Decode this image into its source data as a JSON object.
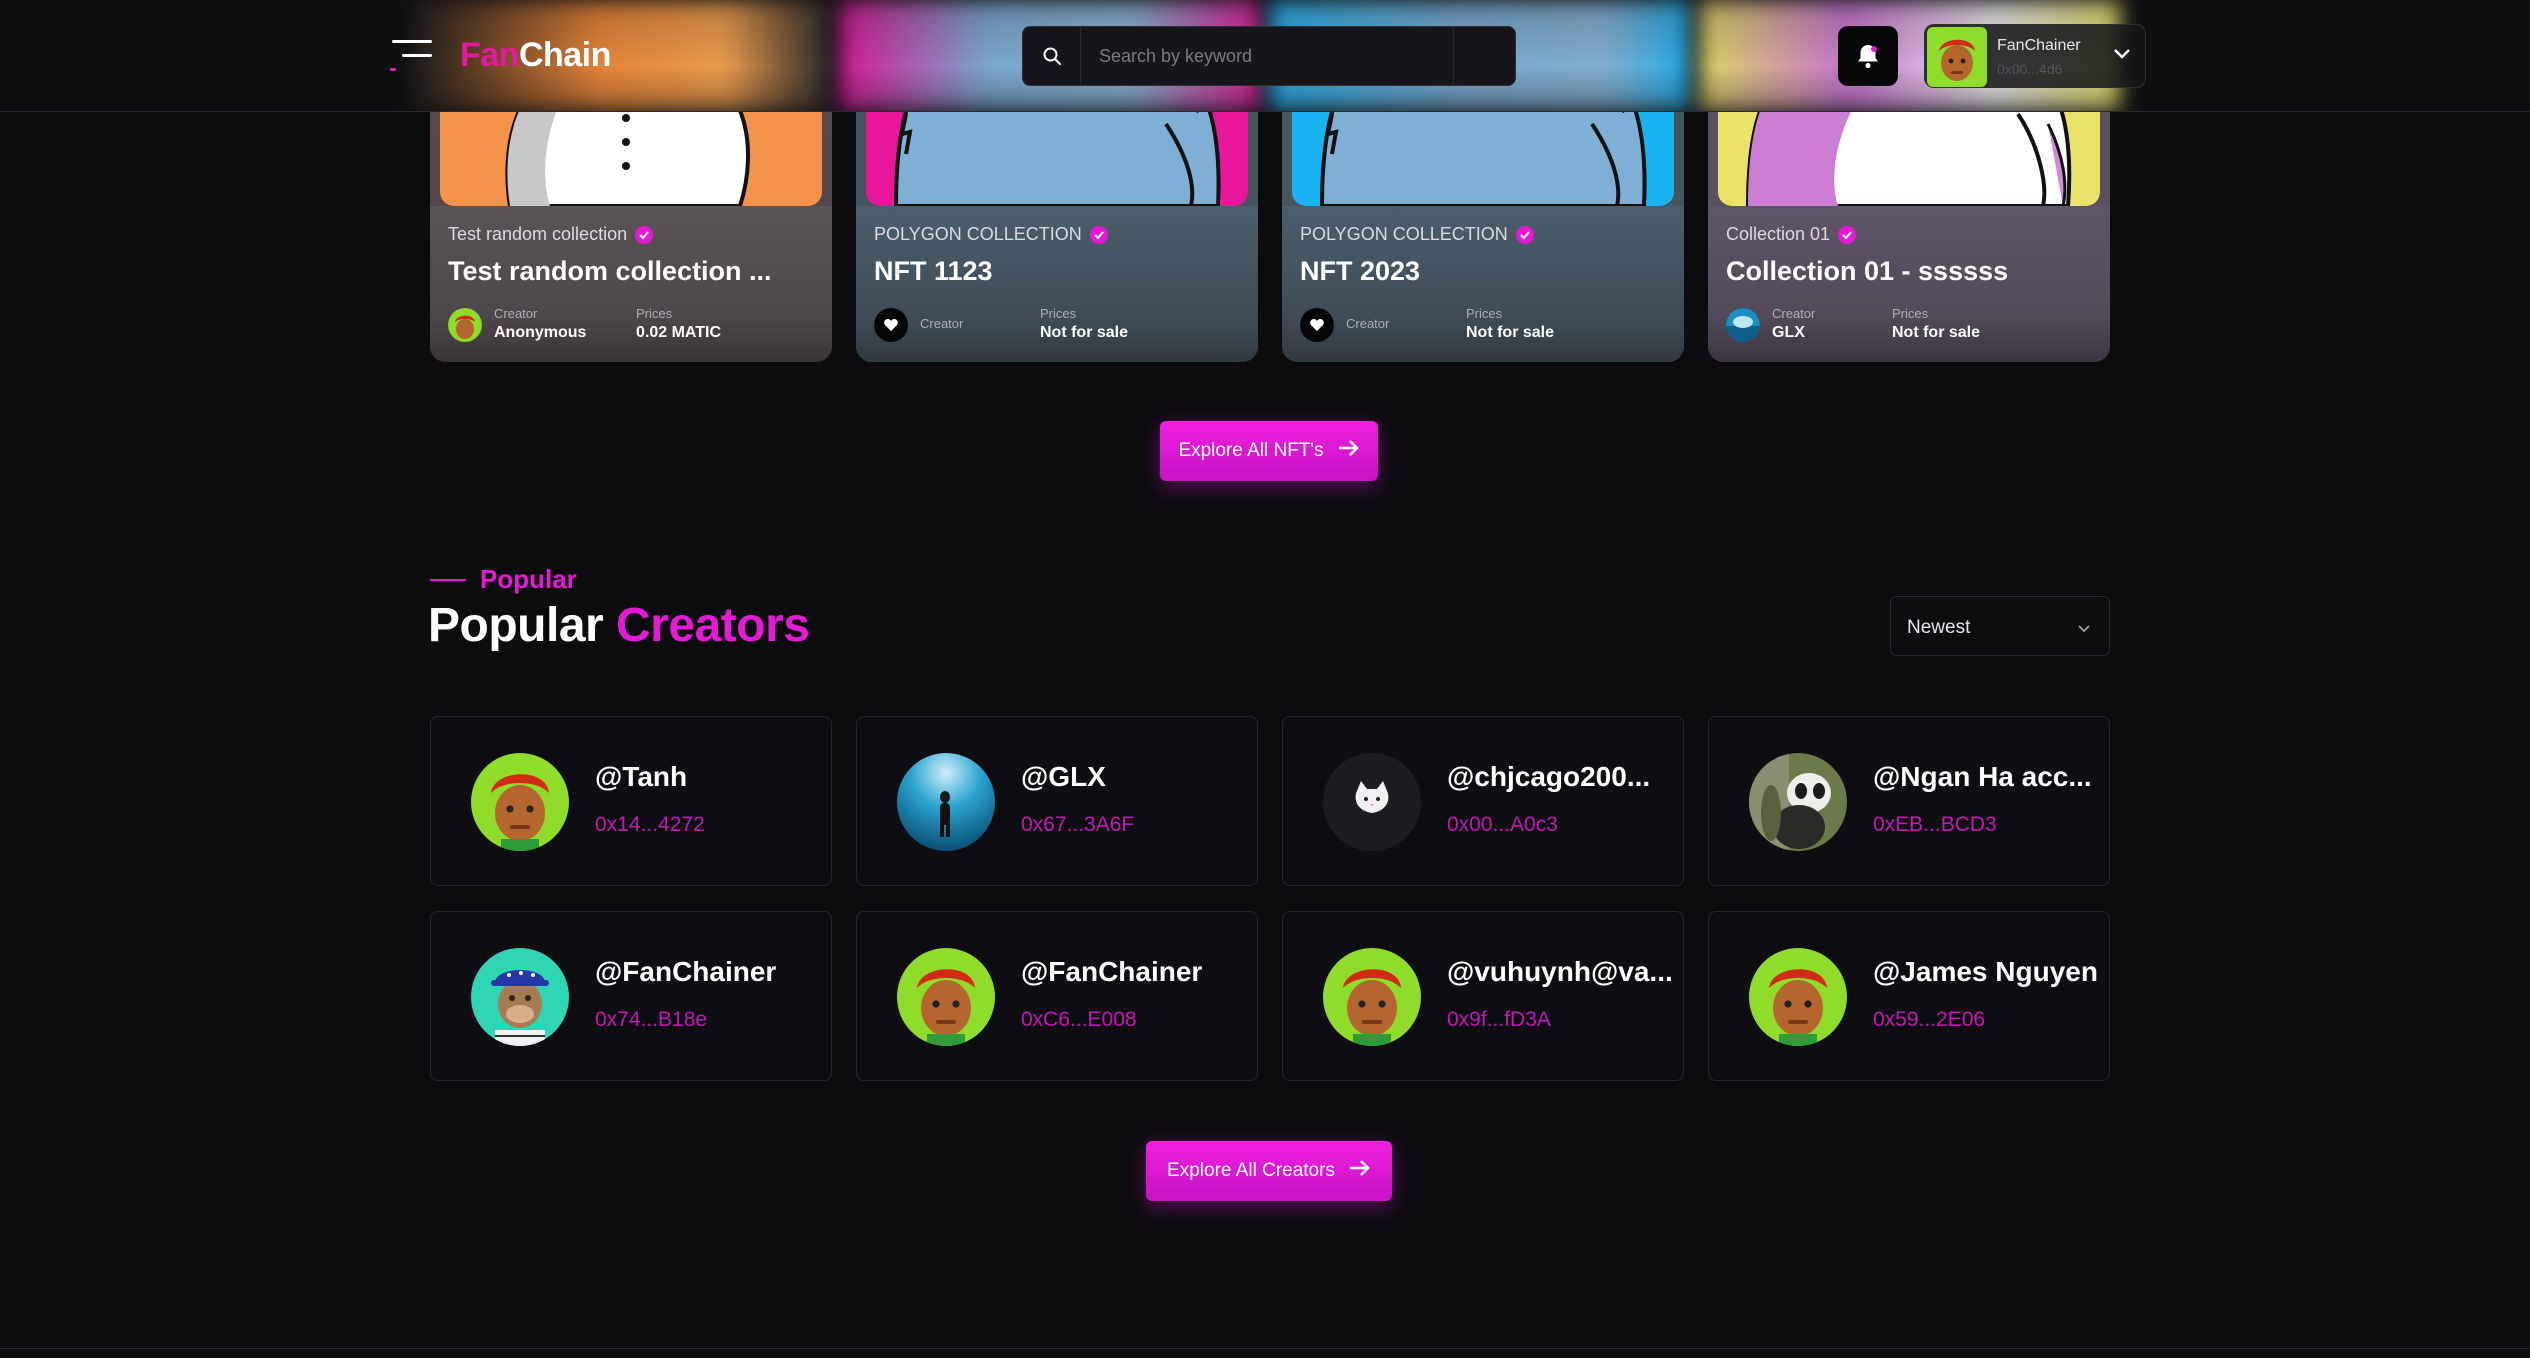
{
  "header": {
    "logo_fan": "Fan",
    "logo_chain": "Chain",
    "search_placeholder": "Search by keyword",
    "user_name": "FanChainer",
    "user_address": "0x00...4d6"
  },
  "nfts": [
    {
      "collection": "Test random collection",
      "title": "Test random collection ...",
      "creator_label": "Creator",
      "creator": "Anonymous",
      "price_label": "Prices",
      "price": "0.02 MATIC"
    },
    {
      "collection": "POLYGON COLLECTION",
      "title": "NFT 1123",
      "creator_label": "Creator",
      "price_label": "Prices",
      "price": "Not for sale"
    },
    {
      "collection": "POLYGON COLLECTION",
      "title": "NFT 2023",
      "creator_label": "Creator",
      "price_label": "Prices",
      "price": "Not for sale"
    },
    {
      "collection": "Collection 01",
      "title": "Collection 01 - ssssss",
      "creator_label": "Creator",
      "creator": "GLX",
      "price_label": "Prices",
      "price": "Not for sale"
    }
  ],
  "explore_nfts_label": "Explore All NFT's",
  "popular": {
    "kicker": "Popular",
    "title_white": "Popular",
    "title_pink": "Creators",
    "sort_value": "Newest"
  },
  "creators": [
    {
      "name": "@Tanh",
      "address": "0x14...4272",
      "avatar": "ape-red-hair"
    },
    {
      "name": "@GLX",
      "address": "0x67...3A6F",
      "avatar": "diver-underwater"
    },
    {
      "name": "@chjcago200...",
      "address": "0x00...A0c3",
      "avatar": "white-cat"
    },
    {
      "name": "@Ngan Ha acc...",
      "address": "0xEB...BCD3",
      "avatar": "panda-photo"
    },
    {
      "name": "@FanChainer",
      "address": "0x74...B18e",
      "avatar": "bored-ape-cap"
    },
    {
      "name": "@FanChainer",
      "address": "0xC6...E008",
      "avatar": "ape-red-hair"
    },
    {
      "name": "@vuhuynh@va...",
      "address": "0x9f...fD3A",
      "avatar": "ape-red-hair"
    },
    {
      "name": "@James Nguyen",
      "address": "0x59...2E06",
      "avatar": "ape-red-hair"
    }
  ],
  "explore_creators_label": "Explore All Creators",
  "colors": {
    "accent": "#e619d6",
    "logo_pink": "#e8189f",
    "background": "#0c0c0f"
  }
}
